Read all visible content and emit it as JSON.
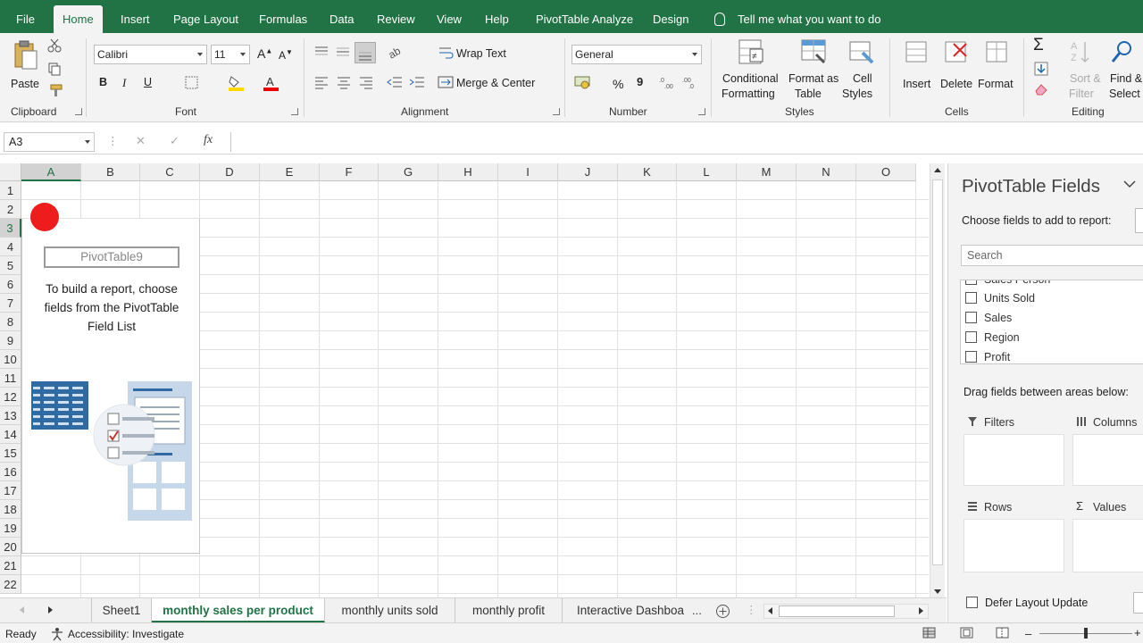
{
  "ribbon_tabs": {
    "file": "File",
    "home": "Home",
    "insert": "Insert",
    "page_layout": "Page Layout",
    "formulas": "Formulas",
    "data": "Data",
    "review": "Review",
    "view": "View",
    "help": "Help",
    "pivot_analyze": "PivotTable Analyze",
    "design": "Design",
    "tell_me": "Tell me what you want to do"
  },
  "clipboard": {
    "paste": "Paste",
    "label": "Clipboard"
  },
  "font": {
    "name": "Calibri",
    "size": "11",
    "bold": "B",
    "italic": "I",
    "underline": "U",
    "label": "Font"
  },
  "alignment": {
    "wrap_text": "Wrap Text",
    "merge_center": "Merge & Center",
    "label": "Alignment"
  },
  "number": {
    "format": "General",
    "percent": "%",
    "comma": "9",
    "label": "Number"
  },
  "styles": {
    "conditional_1": "Conditional",
    "conditional_2": "Formatting",
    "format_table_1": "Format as",
    "format_table_2": "Table",
    "cell_styles_1": "Cell",
    "cell_styles_2": "Styles",
    "label": "Styles"
  },
  "cells": {
    "insert": "Insert",
    "delete": "Delete",
    "format": "Format",
    "label": "Cells"
  },
  "editing": {
    "sort_1": "Sort &",
    "sort_2": "Filter",
    "find_1": "Find &",
    "find_2": "Select",
    "sigma": "Σ",
    "label": "Editing"
  },
  "formula_bar": {
    "name_box": "A3",
    "cancel": "✕",
    "enter": "✓",
    "fx": "fx",
    "formula": ""
  },
  "grid": {
    "columns": [
      "A",
      "B",
      "C",
      "D",
      "E",
      "F",
      "G",
      "H",
      "I",
      "J",
      "K",
      "L",
      "M",
      "N",
      "O"
    ],
    "rows": [
      "1",
      "2",
      "3",
      "4",
      "5",
      "6",
      "7",
      "8",
      "9",
      "10",
      "11",
      "12",
      "13",
      "14",
      "15",
      "16",
      "17",
      "18",
      "19",
      "20",
      "21",
      "22"
    ],
    "active_cell": "A3"
  },
  "pivot_placeholder": {
    "name": "PivotTable9",
    "line1": "To build a report, choose",
    "line2": "fields from the PivotTable",
    "line3": "Field List"
  },
  "sheet_tabs": [
    "Sheet1",
    "monthly sales per product",
    "monthly units sold",
    "monthly profit",
    "Interactive Dashboa"
  ],
  "sheet_more": "...",
  "status": {
    "ready": "Ready",
    "accessibility": "Accessibility: Investigate"
  },
  "pivot_pane": {
    "title": "PivotTable Fields",
    "choose": "Choose fields to add to report:",
    "search_placeholder": "Search",
    "fields": [
      "Sales Person",
      "Units Sold",
      "Sales",
      "Region",
      "Profit"
    ],
    "drag_hint": "Drag fields between areas below:",
    "filters": "Filters",
    "columns": "Columns",
    "rows": "Rows",
    "values": "Values",
    "values_icon": "Σ",
    "defer": "Defer Layout Update"
  },
  "colors": {
    "excel_green": "#217346",
    "ribbon_bg": "#f3f3f3",
    "marker_red": "#ee1c1c"
  }
}
